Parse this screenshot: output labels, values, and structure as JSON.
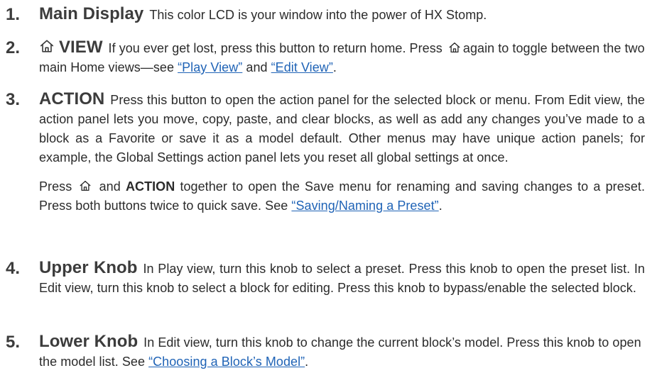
{
  "items": [
    {
      "number": "1.",
      "term": "Main Display",
      "text": "This color LCD is your window into the power of HX Stomp."
    },
    {
      "number": "2.",
      "icon": "home-icon",
      "term": "VIEW",
      "text_a": "If you ever get lost, press this button to return home. Press",
      "text_b": "again to toggle between the two main Home views—see",
      "link_1": "“Play View”",
      "text_c": "and",
      "link_2": "“Edit View”",
      "text_d": "."
    },
    {
      "number": "3.",
      "term": "ACTION",
      "text": "Press this button to open the action panel for the selected block or menu. From Edit view, the action panel lets you move, copy, paste, and clear blocks, as well as add any changes you’ve made to a block as a Favorite or save it as a model default. Other menus may have unique action panels; for example, the Global Settings action panel lets you reset all global settings at once.",
      "para2_a": "Press",
      "para2_icon": "home-icon",
      "para2_and": "and",
      "para2_action": "ACTION",
      "para2_b": "together to open the Save menu for renaming and saving changes to a preset. Press both buttons twice to quick save. See",
      "para2_link": "“Saving/Naming a Preset”",
      "para2_end": "."
    },
    {
      "number": "4.",
      "term": "Upper Knob",
      "text": "In Play view, turn this knob to select a preset. Press this knob to open the preset list. In Edit view, turn this knob to select a block for editing. Press this knob to bypass/enable the selected block."
    },
    {
      "number": "5.",
      "term": "Lower Knob",
      "text": "In Edit view, turn this knob to change the current block’s model. Press this knob to open the model list. See",
      "link": "“Choosing a Block’s Model”",
      "text_end": "."
    }
  ],
  "colors": {
    "text": "#2b2b2b",
    "heading": "#3c3c3c",
    "link": "#1f63b6"
  }
}
